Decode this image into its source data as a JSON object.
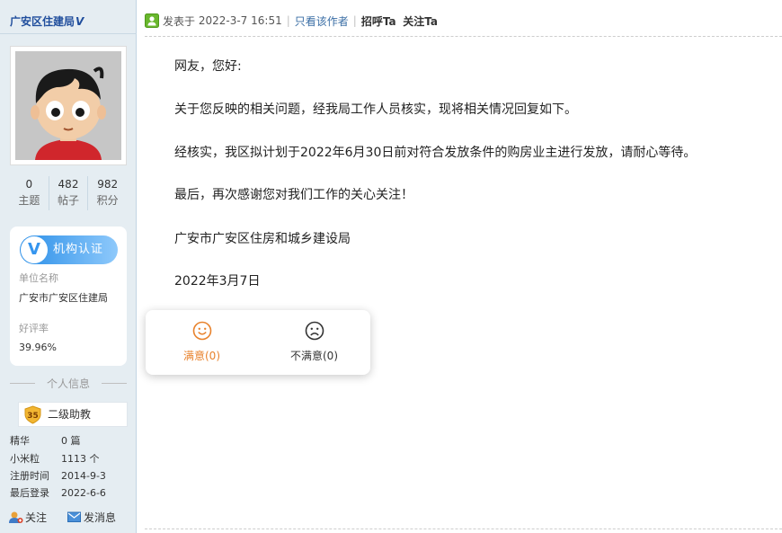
{
  "sidebar": {
    "username": "广安区住建局",
    "verified_mark": "V",
    "stats": [
      {
        "value": "0",
        "label": "主题"
      },
      {
        "value": "482",
        "label": "帖子"
      },
      {
        "value": "982",
        "label": "积分"
      }
    ],
    "org": {
      "badge_text": "机构认证",
      "unit_label": "单位名称",
      "unit_value": "广安市广安区住建局",
      "rating_label": "好评率",
      "rating_value": "39.96%"
    },
    "personal_info_title": "个人信息",
    "level": {
      "number": "35",
      "name": "二级助教"
    },
    "info": [
      {
        "key": "精华",
        "value": "0 篇"
      },
      {
        "key": "小米粒",
        "value": "1113 个"
      },
      {
        "key": "注册时间",
        "value": "2014-9-3"
      },
      {
        "key": "最后登录",
        "value": "2022-6-6"
      }
    ],
    "actions": {
      "follow": "关注",
      "message": "发消息"
    }
  },
  "post": {
    "posted_prefix": "发表于",
    "posted_time": "2022-3-7 16:51",
    "only_author": "只看该作者",
    "greet": "招呼Ta",
    "follow": "关注Ta",
    "paragraphs": [
      "网友，您好:",
      "关于您反映的相关问题，经我局工作人员核实，现将相关情况回复如下。",
      "经核实，我区拟计划于2022年6月30日前对符合发放条件的购房业主进行发放，请耐心等待。",
      "最后，再次感谢您对我们工作的关心关注！",
      "广安市广安区住房和城乡建设局",
      "2022年3月7日"
    ]
  },
  "rating": {
    "satisfied": "满意(0)",
    "unsatisfied": "不满意(0)"
  },
  "colors": {
    "sidebar_bg": "#e5edf2",
    "link_blue": "#3a6ea5",
    "satisfied_orange": "#e8822c",
    "verified_blue": "#2b8fe8"
  }
}
